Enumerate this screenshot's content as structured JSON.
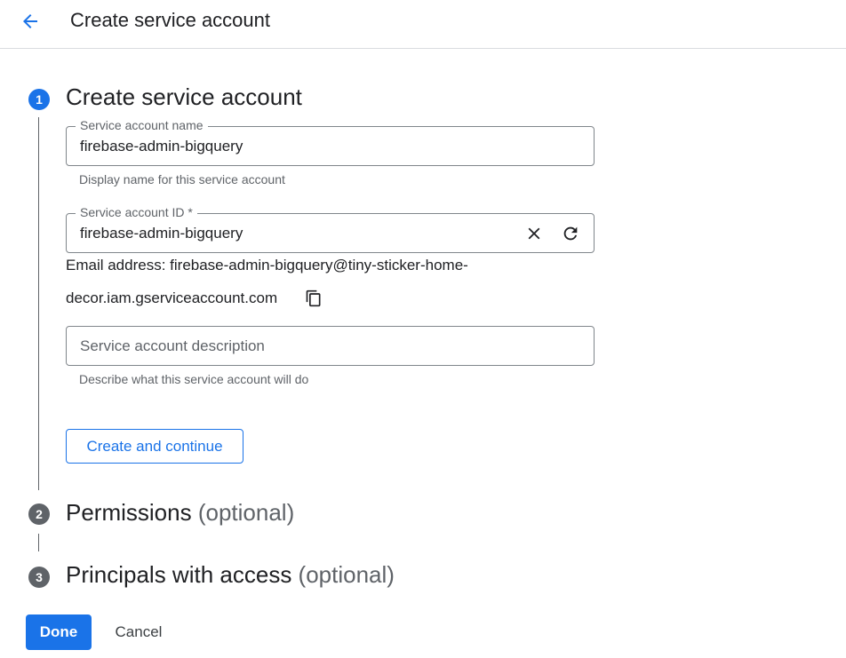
{
  "header": {
    "title": "Create service account",
    "back_icon": "arrow-back-icon"
  },
  "steps": [
    {
      "number": "1",
      "title": "Create service account",
      "optional": ""
    },
    {
      "number": "2",
      "title": "Permissions",
      "optional": "(optional)"
    },
    {
      "number": "3",
      "title": "Principals with access",
      "optional": "(optional)"
    }
  ],
  "form": {
    "name_field": {
      "label": "Service account name",
      "value": "firebase-admin-bigquery",
      "hint": "Display name for this service account"
    },
    "id_field": {
      "label": "Service account ID *",
      "value": "firebase-admin-bigquery",
      "clear_icon": "close-icon",
      "refresh_icon": "refresh-icon"
    },
    "email": {
      "line1": "Email address: firebase-admin-bigquery@tiny-sticker-home-",
      "line2": "decor.iam.gserviceaccount.com",
      "copy_icon": "copy-icon"
    },
    "description_field": {
      "placeholder": "Service account description",
      "hint": "Describe what this service account will do"
    },
    "create_button": "Create and continue"
  },
  "footer": {
    "done_label": "Done",
    "cancel_label": "Cancel"
  },
  "colors": {
    "accent": "#1a73e8",
    "inactive_step": "#5f6368",
    "border": "#80868b",
    "text": "#202124",
    "secondary_text": "#5f6368"
  }
}
